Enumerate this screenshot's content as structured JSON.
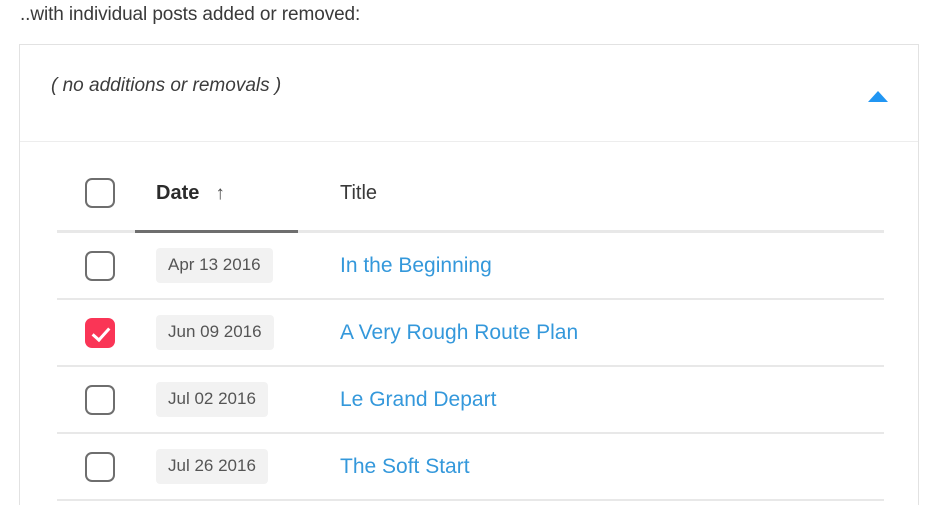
{
  "page": {
    "heading": "..with individual posts added or removed:"
  },
  "panel": {
    "summary_label": "( no additions or removals )",
    "collapse_icon": "caret-up-icon",
    "accent_blue": "#2196f3"
  },
  "table": {
    "columns": {
      "select_all": "",
      "date": "Date",
      "date_sort_arrow": "↑",
      "title": "Title"
    },
    "sort": {
      "column": "Date",
      "direction": "ascending"
    },
    "colors": {
      "link": "#3498db",
      "checked_checkbox": "#fa3556",
      "date_pill_bg": "#f2f2f2"
    },
    "rows": [
      {
        "selected": false,
        "date": "Apr 13 2016",
        "title": "In the Beginning"
      },
      {
        "selected": true,
        "date": "Jun 09 2016",
        "title": "A Very Rough Route Plan"
      },
      {
        "selected": false,
        "date": "Jul 02 2016",
        "title": "Le Grand Depart"
      },
      {
        "selected": false,
        "date": "Jul 26 2016",
        "title": "The Soft Start"
      }
    ]
  }
}
